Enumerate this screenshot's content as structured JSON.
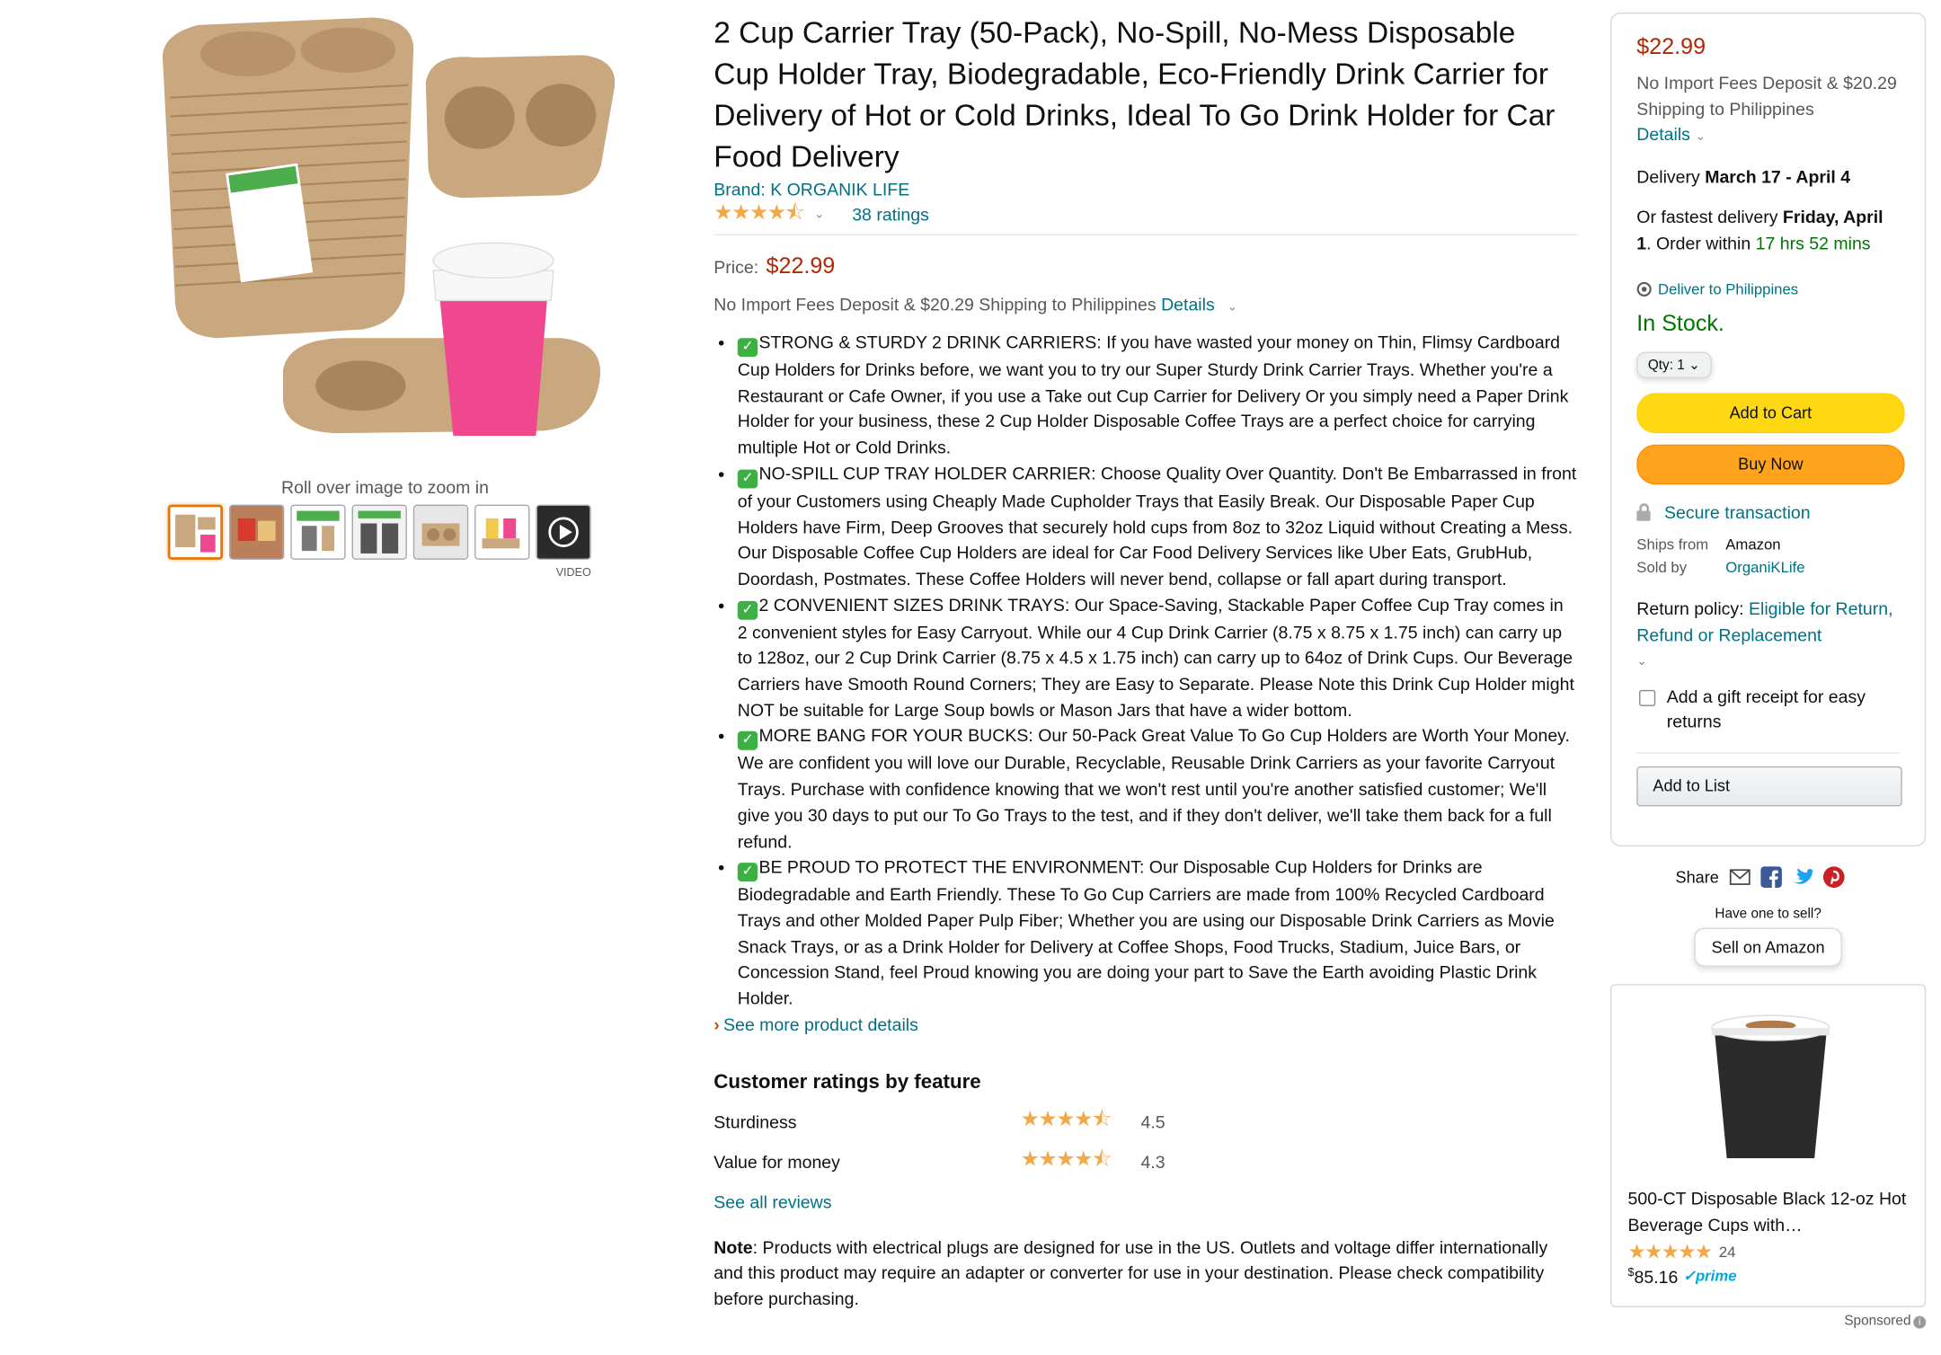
{
  "product": {
    "title": "2 Cup Carrier Tray (50-Pack), No-Spill, No-Mess Disposable Cup Holder Tray, Biodegradable, Eco-Friendly Drink Carrier for Delivery of Hot or Cold Drinks, Ideal To Go Drink Holder for Car Food Delivery",
    "brand_link": "Brand: K ORGANIK LIFE",
    "stars": "★★★★⯪",
    "rating_value": 4.4,
    "ratings_count": "38 ratings",
    "price_label": "Price:",
    "price": "$22.99",
    "shipping_text": "No Import Fees Deposit & $20.29 Shipping to Philippines",
    "details_link": "Details"
  },
  "gallery": {
    "zoom_hint": "Roll over image to zoom in",
    "video_label": "VIDEO",
    "thumbnails": [
      "main",
      "thumb-2",
      "thumb-3",
      "thumb-4",
      "thumb-5",
      "thumb-6",
      "video"
    ]
  },
  "bullets": [
    {
      "check": "✓",
      "text": "STRONG & STURDY 2 DRINK CARRIERS:  If you have wasted your money on Thin, Flimsy Cardboard Cup Holders for Drinks before, we want you to try our Super Sturdy Drink Carrier Trays.  Whether you're a Restaurant or Cafe Owner, if you use a Take out Cup Carrier for Delivery Or you simply need a Paper Drink Holder for your business, these 2 Cup Holder Disposable Coffee Trays are a perfect choice for carrying multiple Hot or Cold Drinks."
    },
    {
      "check": "✓",
      "text": "NO-SPILL CUP TRAY HOLDER CARRIER: Choose Quality Over Quantity. Don't Be Embarrassed in front of your Customers using Cheaply Made Cupholder Trays that Easily Break. Our Disposable Paper Cup Holders have Firm, Deep Grooves that securely hold cups from 8oz to 32oz Liquid without Creating a Mess.  Our Disposable Coffee Cup Holders are ideal for Car Food Delivery Services like Uber Eats, GrubHub, Doordash, Postmates. These Coffee Holders will never bend, collapse or fall apart during transport."
    },
    {
      "check": "✓",
      "text": "2 CONVENIENT SIZES DRINK TRAYS: Our Space-Saving, Stackable Paper Coffee Cup Tray comes in 2 convenient styles for Easy Carryout. While our 4 Cup Drink Carrier (8.75 x 8.75 x 1.75 inch) can carry up to 128oz, our 2 Cup Drink Carrier (8.75 x 4.5 x 1.75 inch) can carry up to 64oz of Drink Cups.  Our Beverage Carriers have Smooth Round Corners;  They are Easy to Separate.  Please Note this Drink Cup Holder might NOT be suitable for Large Soup bowls or Mason Jars that have a wider bottom."
    },
    {
      "check": "✓",
      "text": "MORE BANG FOR YOUR BUCKS:  Our 50-Pack Great Value To Go Cup Holders are Worth Your Money. We are confident you will love our Durable, Recyclable, Reusable Drink Carriers as your favorite Carryout Trays.  Purchase with confidence knowing that we won't rest until you're another satisfied customer; We'll give you 30 days to put our To Go Trays to the test, and if they don't deliver, we'll take them back for a full refund."
    },
    {
      "check": "✓",
      "text": "BE PROUD TO PROTECT THE ENVIRONMENT:  Our Disposable Cup Holders for Drinks are Biodegradable and Earth Friendly. These To Go Cup Carriers are made from 100% Recycled Cardboard Trays and other Molded Paper Pulp Fiber; Whether you are using our Disposable Drink Carriers as Movie Snack Trays, or as a Drink Holder for Delivery at Coffee Shops, Food Trucks, Stadium, Juice Bars, or Concession Stand, feel Proud knowing you are doing your part to Save the Earth avoiding Plastic Drink Holder."
    }
  ],
  "see_more": "See more product details",
  "features": {
    "title": "Customer ratings by feature",
    "rows": [
      {
        "name": "Sturdiness",
        "stars": "★★★★⯪",
        "score": "4.5"
      },
      {
        "name": "Value for money",
        "stars": "★★★★⯪",
        "score": "4.3"
      }
    ],
    "see_all": "See all reviews"
  },
  "note": {
    "label": "Note",
    "text": ": Products with electrical plugs are designed for use in the US. Outlets and voltage differ internationally and this product may require an adapter or converter for use in your destination. Please check compatibility before purchasing."
  },
  "buybox": {
    "price": "$22.99",
    "import_text": "No Import Fees Deposit & $20.29 Shipping to Philippines",
    "details_link": "Details",
    "delivery_prefix": "Delivery ",
    "delivery_dates": "March 17 - April 4",
    "fastest_prefix": "Or fastest delivery ",
    "fastest_date": "Friday, April 1",
    "order_within_prefix": ". Order within ",
    "order_within": "17 hrs 52 mins",
    "deliver_to": "Deliver to Philippines",
    "stock": "In Stock.",
    "qty": "Qty: 1",
    "add_to_cart": "Add to Cart",
    "buy_now": "Buy Now",
    "secure": "Secure transaction",
    "ships_from_label": "Ships from",
    "ships_from": "Amazon",
    "sold_by_label": "Sold by",
    "sold_by": "OrganiKLife",
    "return_prefix": "Return policy: ",
    "return_link": "Eligible for Return, Refund or Replacement",
    "gift_receipt": "Add a gift receipt for easy returns",
    "add_to_list": "Add to List"
  },
  "share": {
    "label": "Share",
    "have_one": "Have one to sell?",
    "sell_button": "Sell on Amazon"
  },
  "ad": {
    "title": "500-CT Disposable Black 12-oz Hot Beverage Cups with…",
    "stars": "★★★★★",
    "rating_count": "24",
    "price_symbol": "$",
    "price": "85.16",
    "prime": "✓prime",
    "sponsored": "Sponsored",
    "info_icon": "i"
  },
  "colors": {
    "price": "#b12704",
    "link": "#007185",
    "stock": "#007600",
    "add_to_cart": "#ffd814",
    "buy_now": "#ffa41c",
    "stars": "#f3a847"
  }
}
